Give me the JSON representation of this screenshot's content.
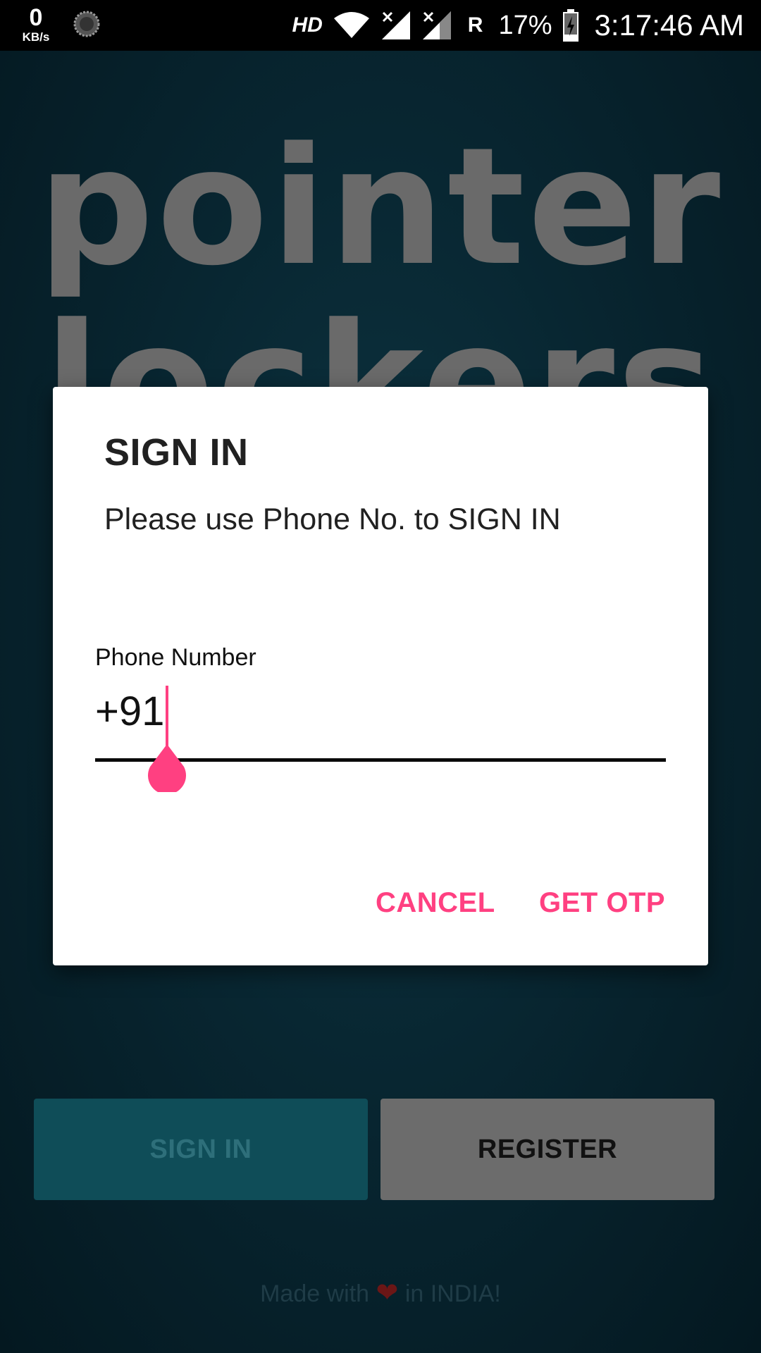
{
  "status_bar": {
    "net_speed_value": "0",
    "net_speed_unit": "KB/s",
    "hd_label": "HD",
    "roaming_label": "R",
    "battery_percent": "17%",
    "time": "3:17:46 AM"
  },
  "background": {
    "logo_line1": "pointer",
    "logo_line2": "lockers",
    "signin_button": "SIGN IN",
    "register_button": "REGISTER",
    "footer_prefix": "Made with",
    "footer_suffix": "in INDIA!"
  },
  "dialog": {
    "title": "SIGN IN",
    "message": "Please use Phone No. to SIGN IN",
    "phone_label": "Phone Number",
    "phone_value": "+91",
    "cancel_button": "CANCEL",
    "otp_button": "GET OTP"
  },
  "colors": {
    "accent": "#ff4081",
    "background": "#082631",
    "signin_bg": "#0f4d58",
    "register_bg": "#6c6c6c"
  }
}
